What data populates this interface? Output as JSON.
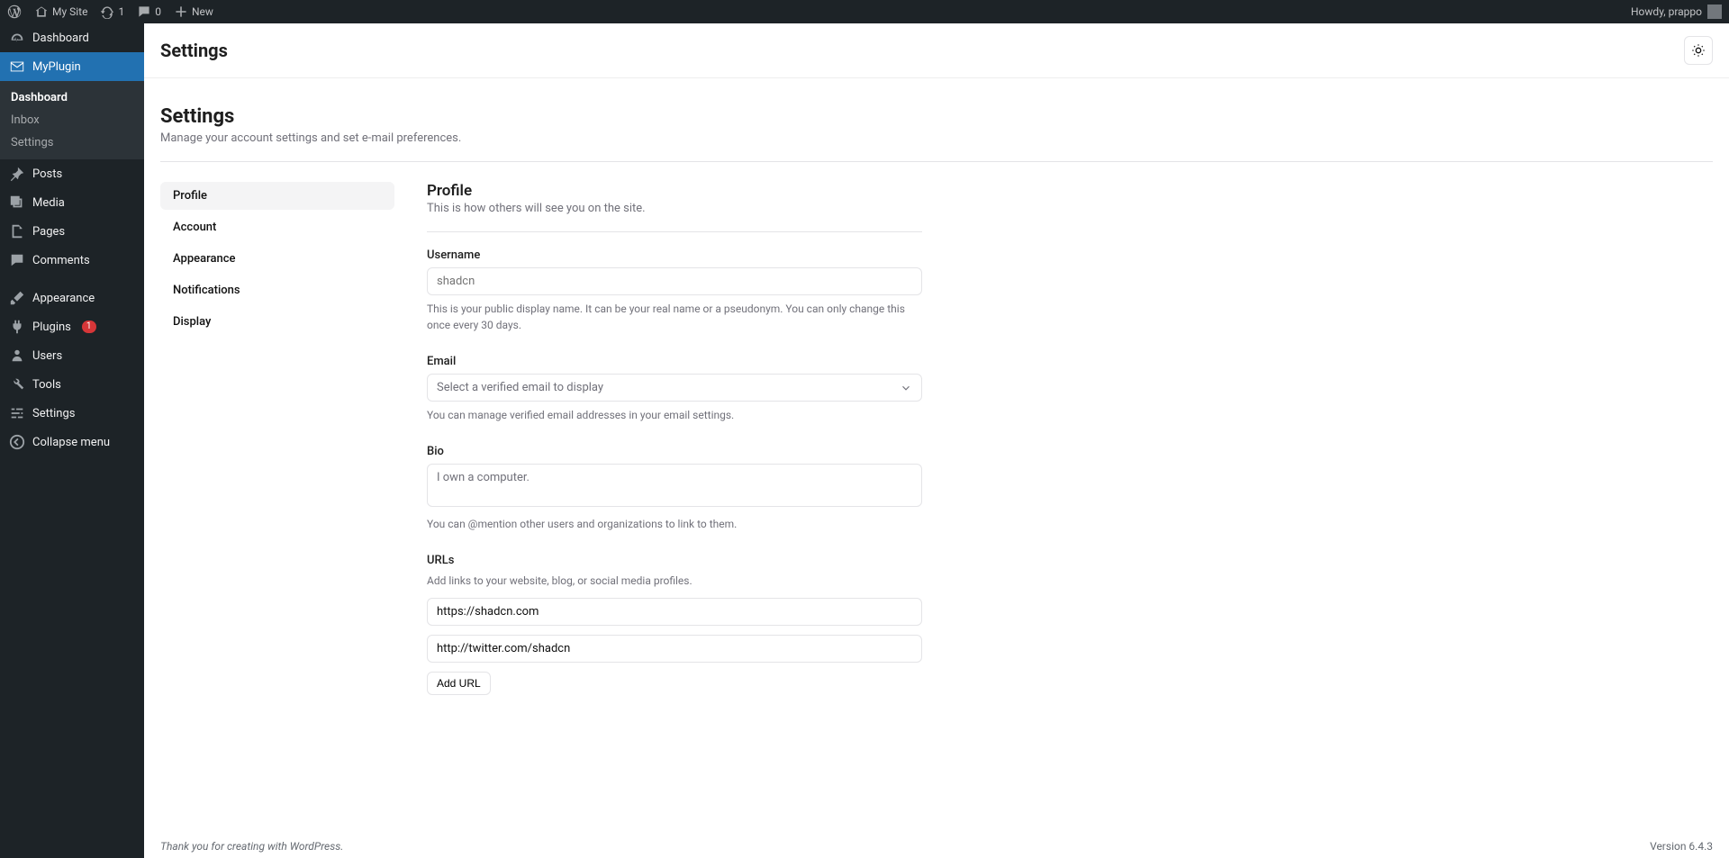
{
  "adminbar": {
    "site_name": "My Site",
    "updates_count": "1",
    "comments_count": "0",
    "new_label": "New",
    "greeting": "Howdy, prappo"
  },
  "sidebar": {
    "dashboard": "Dashboard",
    "myplugin": "MyPlugin",
    "sub_dashboard": "Dashboard",
    "sub_inbox": "Inbox",
    "sub_settings": "Settings",
    "posts": "Posts",
    "media": "Media",
    "pages": "Pages",
    "comments": "Comments",
    "appearance": "Appearance",
    "plugins": "Plugins",
    "plugins_badge": "1",
    "users": "Users",
    "tools": "Tools",
    "settings": "Settings",
    "collapse": "Collapse menu"
  },
  "topbar": {
    "title": "Settings"
  },
  "page": {
    "title": "Settings",
    "subtitle": "Manage your account settings and set e-mail preferences.",
    "tabs": [
      "Profile",
      "Account",
      "Appearance",
      "Notifications",
      "Display"
    ]
  },
  "profile": {
    "heading": "Profile",
    "subtitle": "This is how others will see you on the site.",
    "username_label": "Username",
    "username_placeholder": "shadcn",
    "username_desc": "This is your public display name. It can be your real name or a pseudonym. You can only change this once every 30 days.",
    "email_label": "Email",
    "email_placeholder": "Select a verified email to display",
    "email_desc": "You can manage verified email addresses in your email settings.",
    "bio_label": "Bio",
    "bio_value": "I own a computer.",
    "bio_desc": "You can @mention other users and organizations to link to them.",
    "urls_label": "URLs",
    "urls_desc": "Add links to your website, blog, or social media profiles.",
    "url1": "https://shadcn.com",
    "url2": "http://twitter.com/shadcn",
    "add_url": "Add URL"
  },
  "footer": {
    "thanks": "Thank you for creating with WordPress.",
    "version": "Version 6.4.3"
  }
}
